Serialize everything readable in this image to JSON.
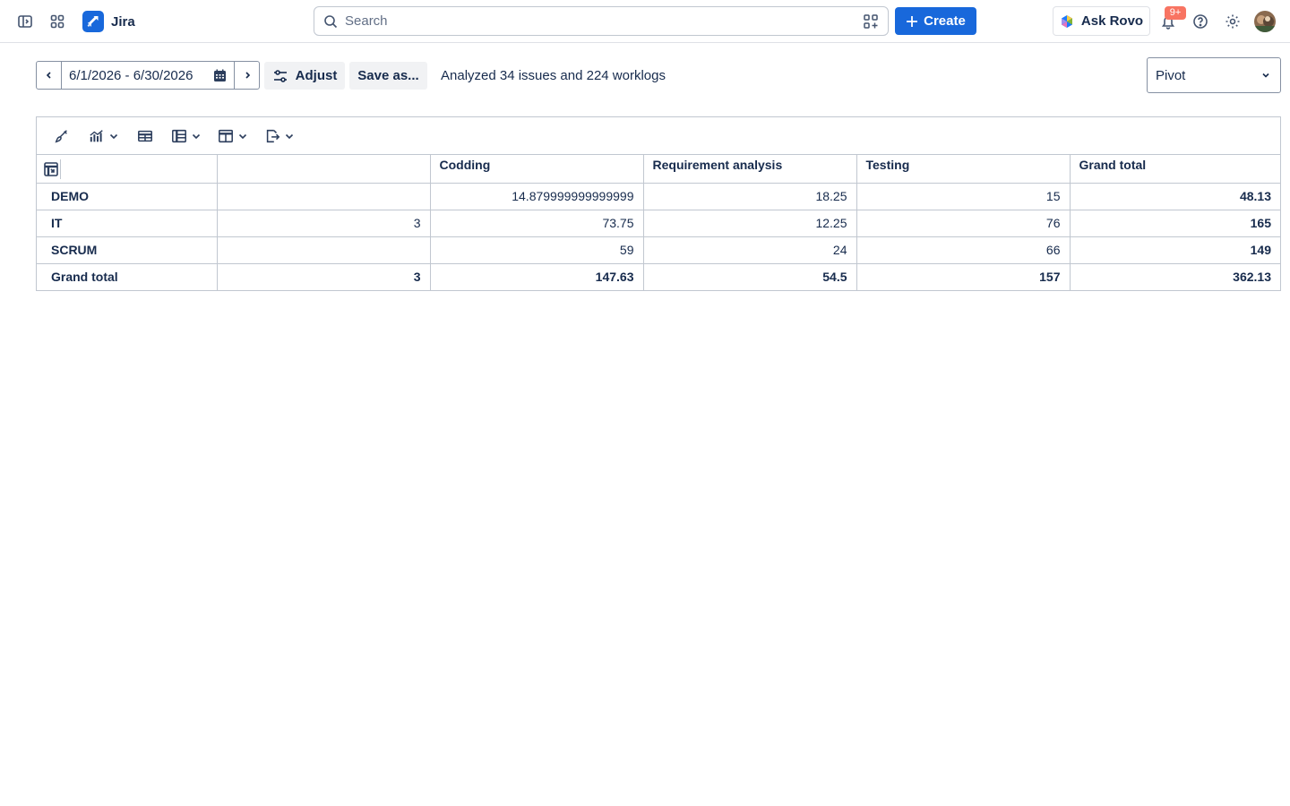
{
  "app": {
    "name": "Jira"
  },
  "topnav": {
    "search_placeholder": "Search",
    "create_label": "Create",
    "rovo_label": "Ask Rovo",
    "notification_count": "9+"
  },
  "toolbar": {
    "date_range": "6/1/2026 - 6/30/2026",
    "adjust_label": "Adjust",
    "save_as_label": "Save as...",
    "analyzed_text": "Analyzed 34 issues and 224 worklogs",
    "view_selected": "Pivot"
  },
  "pivot": {
    "columns": [
      "",
      "Codding",
      "Requirement analysis",
      "Testing",
      "Grand total"
    ],
    "rows": [
      {
        "label": "DEMO",
        "values": [
          "",
          "14.879999999999999",
          "18.25",
          "15"
        ],
        "total": "48.13"
      },
      {
        "label": "IT",
        "values": [
          "3",
          "73.75",
          "12.25",
          "76"
        ],
        "total": "165"
      },
      {
        "label": "SCRUM",
        "values": [
          "",
          "59",
          "24",
          "66"
        ],
        "total": "149"
      }
    ],
    "grand_total": {
      "label": "Grand total",
      "values": [
        "3",
        "147.63",
        "54.5",
        "157"
      ],
      "total": "362.13"
    }
  }
}
